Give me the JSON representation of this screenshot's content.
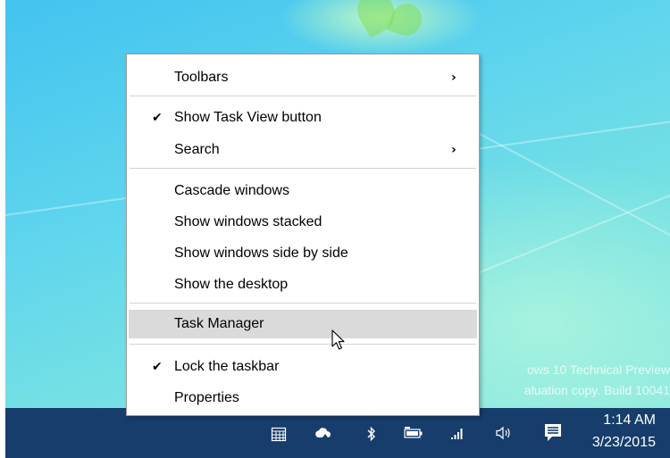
{
  "desktop": {
    "watermark_line1": "ows 10 Technical Preview",
    "watermark_line2": "aluation copy. Build 10041"
  },
  "context_menu": {
    "items": [
      {
        "label": "Toolbars",
        "checked": "",
        "submenu": "›"
      },
      {
        "label": "Show Task View button",
        "checked": "✔",
        "submenu": ""
      },
      {
        "label": "Search",
        "checked": "",
        "submenu": "›"
      },
      {
        "label": "Cascade windows",
        "checked": "",
        "submenu": ""
      },
      {
        "label": "Show windows stacked",
        "checked": "",
        "submenu": ""
      },
      {
        "label": "Show windows side by side",
        "checked": "",
        "submenu": ""
      },
      {
        "label": "Show the desktop",
        "checked": "",
        "submenu": ""
      },
      {
        "label": "Task Manager",
        "checked": "",
        "submenu": ""
      },
      {
        "label": "Lock the taskbar",
        "checked": "✔",
        "submenu": ""
      },
      {
        "label": "Properties",
        "checked": "",
        "submenu": ""
      }
    ],
    "hovered_item": "Task Manager"
  },
  "taskbar": {
    "tray_icons": [
      "calendar-icon",
      "onedrive-cloud-icon",
      "bluetooth-icon",
      "battery-icon",
      "network-signal-icon",
      "volume-icon",
      "action-center-icon"
    ],
    "clock_time": "1:14 AM",
    "clock_date": "3/23/2015"
  },
  "colors": {
    "taskbar": "#163d6b",
    "menu_hover": "#dadada",
    "menu_border": "#9b9b9b"
  }
}
